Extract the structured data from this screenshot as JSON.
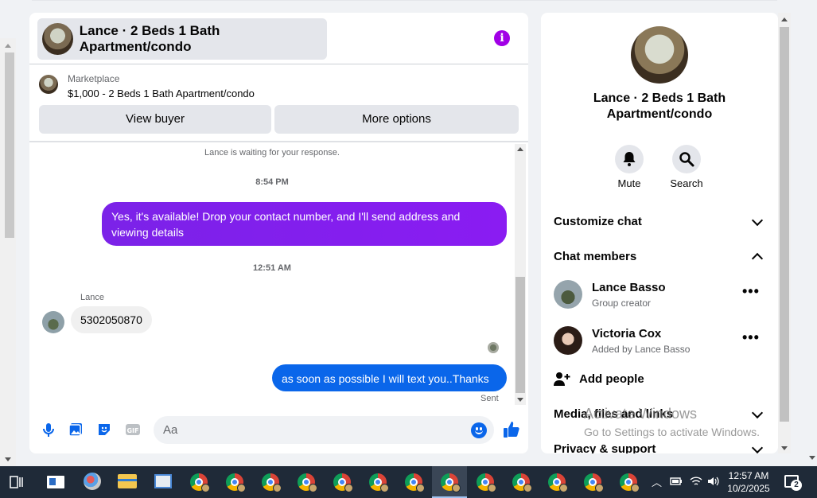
{
  "chat": {
    "title": "Lance · 2 Beds 1 Bath Apartment/condo",
    "marketplace_label": "Marketplace",
    "listing": "$1,000 - 2 Beds 1 Bath Apartment/condo",
    "view_buyer_label": "View buyer",
    "more_options_label": "More options",
    "waiting_text": "Lance is waiting for your response.",
    "messages": [
      {
        "timestamp": "8:54 PM",
        "text": "Yes, it's available! Drop your contact number, and I'll send address and viewing details"
      },
      {
        "timestamp": "12:51 AM",
        "sender": "Lance",
        "text": "5302050870"
      },
      {
        "text": "as soon as possible I will text you..Thanks",
        "status": "Sent"
      }
    ],
    "composer_placeholder": "Aa",
    "accent_color": "#0a66ea"
  },
  "side": {
    "title": "Lance · 2 Beds 1 Bath Apartment/condo",
    "mute_label": "Mute",
    "search_label": "Search",
    "customize_label": "Customize chat",
    "members_label": "Chat members",
    "members": [
      {
        "name": "Lance Basso",
        "sub": "Group creator"
      },
      {
        "name": "Victoria Cox",
        "sub": "Added by Lance Basso"
      }
    ],
    "add_people_label": "Add people",
    "media_label": "Media, files and links",
    "privacy_label": "Privacy & support"
  },
  "watermark": {
    "line1": "Activate Windows",
    "line2": "Go to Settings to activate Windows."
  },
  "taskbar": {
    "time": "12:57 AM",
    "date": "10/2/2025",
    "notification_count": "2"
  }
}
